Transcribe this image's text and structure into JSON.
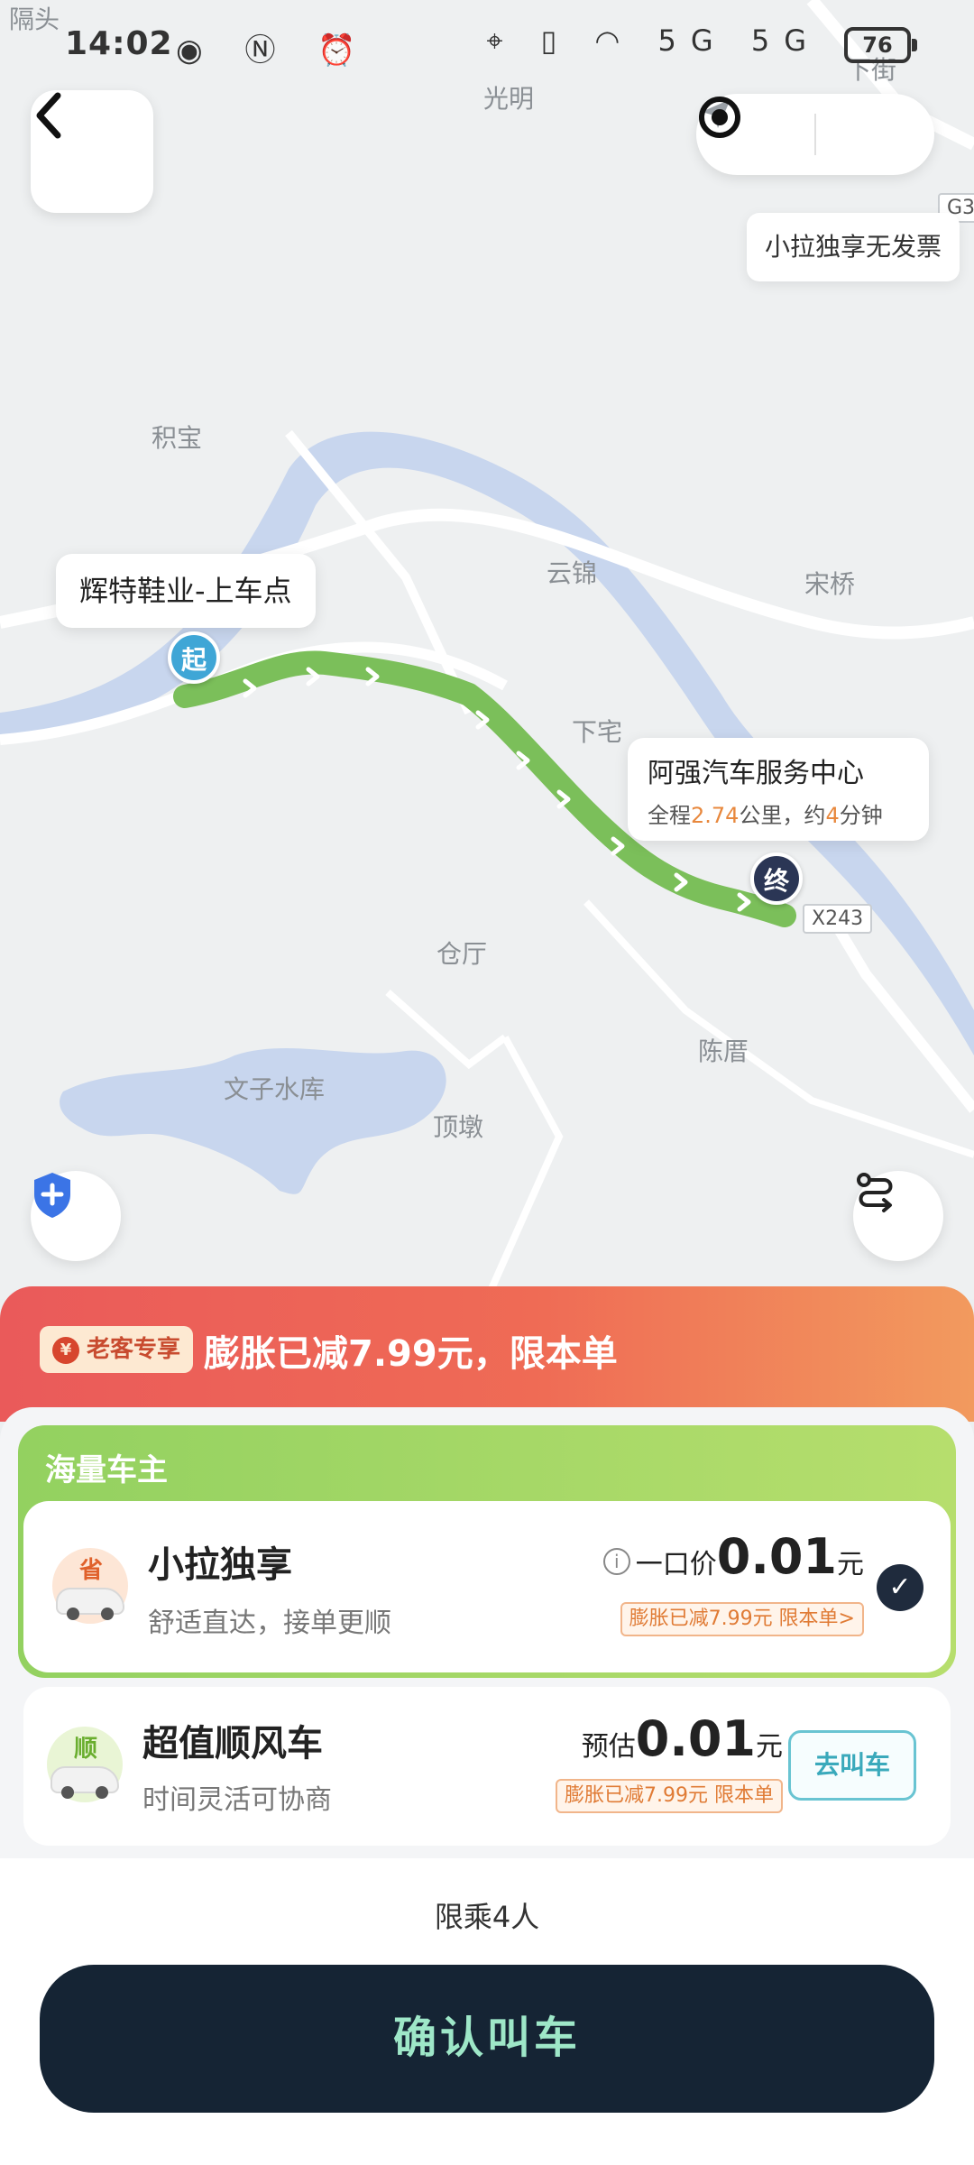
{
  "status_bar": {
    "time": "14:02",
    "battery": "76",
    "network": [
      "5G",
      "5G"
    ]
  },
  "map": {
    "places": {
      "geshou": "隔头",
      "guangming": "光明",
      "xiajie": "下街",
      "jibao": "积宝",
      "yunjin": "云锦",
      "songqiao": "宋桥",
      "xiazhai": "下宅",
      "cangting": "仓厅",
      "chenzhuan": "陈厝",
      "wenzi_reservoir": "文子水库",
      "dingtun": "顶墩"
    },
    "road_tags": {
      "g3": "G3",
      "x243": "X243"
    },
    "invoice_tip": "小拉独享无发票",
    "start": {
      "label": "辉特鞋业-上车点",
      "pin": "起"
    },
    "end": {
      "label": "阿强汽车服务中心",
      "pin": "终",
      "meta_prefix": "全程",
      "distance": "2.74",
      "meta_mid": "公里，约",
      "duration": "4",
      "meta_suffix": "分钟"
    },
    "route_color": "#7bbf5a"
  },
  "promo": {
    "tag": "老客专享",
    "text": "膨胀已减7.99元，限本单"
  },
  "group": {
    "title": "海量车主",
    "options": [
      {
        "badge": "省",
        "title": "小拉独享",
        "subtitle": "舒适直达，接单更顺",
        "price_label": "一口价",
        "price": "0.01",
        "unit": "元",
        "discount": "膨胀已减7.99元 限本单>",
        "selected": true
      }
    ]
  },
  "option2": {
    "badge": "顺",
    "title": "超值顺风车",
    "subtitle": "时间灵活可协商",
    "price_label": "预估",
    "price": "0.01",
    "unit": "元",
    "discount": "膨胀已减7.99元 限本单",
    "button": "去叫车"
  },
  "limit": "限乘4人",
  "confirm": "确认叫车",
  "colors": {
    "accent_green": "#93d160",
    "promo_red": "#ea5a5a",
    "confirm_bg": "#152434",
    "confirm_text": "#9ee7c8"
  }
}
